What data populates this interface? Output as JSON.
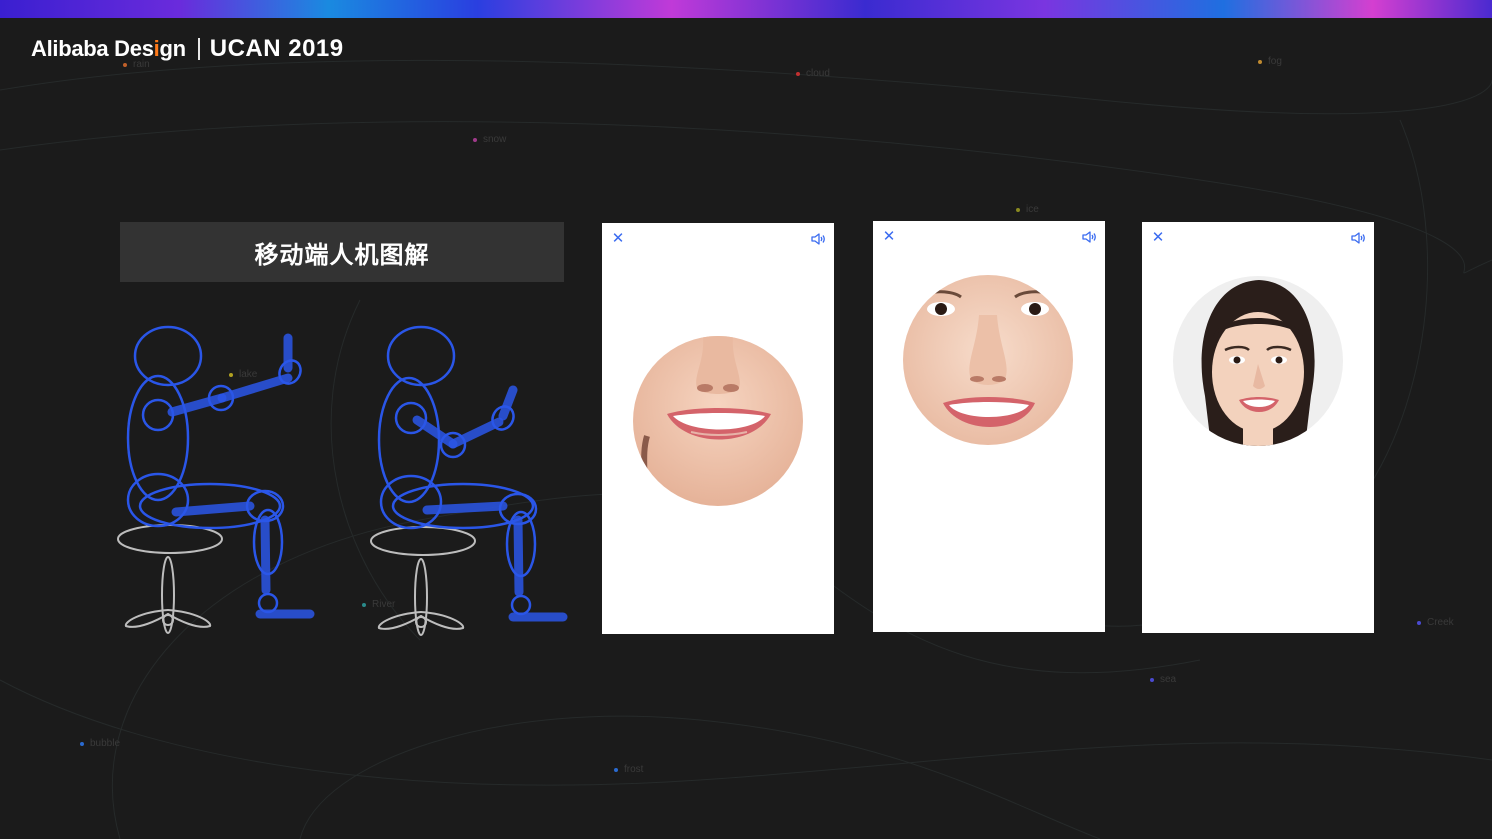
{
  "brand": {
    "name_prefix": "Alibaba Des",
    "name_highlight": "i",
    "name_suffix": "gn",
    "event": "UCAN 2019"
  },
  "colors": {
    "background": "#1b1b1b",
    "accent_blue": "#2a56e8",
    "icon_blue": "#3a6bf0",
    "brand_orange": "#ff7a1a",
    "title_bg": "#333333"
  },
  "background_tags": [
    {
      "text": "rain",
      "color": "#c0602a"
    },
    {
      "text": "cloud",
      "color": "#c03030"
    },
    {
      "text": "fog",
      "color": "#c08a30"
    },
    {
      "text": "snow",
      "color": "#a03a8a"
    },
    {
      "text": "ice",
      "color": "#8a8a20"
    },
    {
      "text": "lake",
      "color": "#b0a020"
    },
    {
      "text": "River",
      "color": "#2a8a8a"
    },
    {
      "text": "Creek",
      "color": "#4a4ad0"
    },
    {
      "text": "sea",
      "color": "#4a4ad0"
    },
    {
      "text": "bubble",
      "color": "#2a6ad0"
    },
    {
      "text": "frost",
      "color": "#2a6ad0"
    }
  ],
  "section": {
    "title": "移动端人机图解"
  },
  "icons": {
    "close": "close-icon",
    "sound": "speaker-icon"
  },
  "phones": [
    {
      "close_glyph": "✕",
      "face_view": "mouth-smile"
    },
    {
      "close_glyph": "✕",
      "face_view": "mid-face-smile"
    },
    {
      "close_glyph": "✕",
      "face_view": "full-face-smile"
    }
  ]
}
